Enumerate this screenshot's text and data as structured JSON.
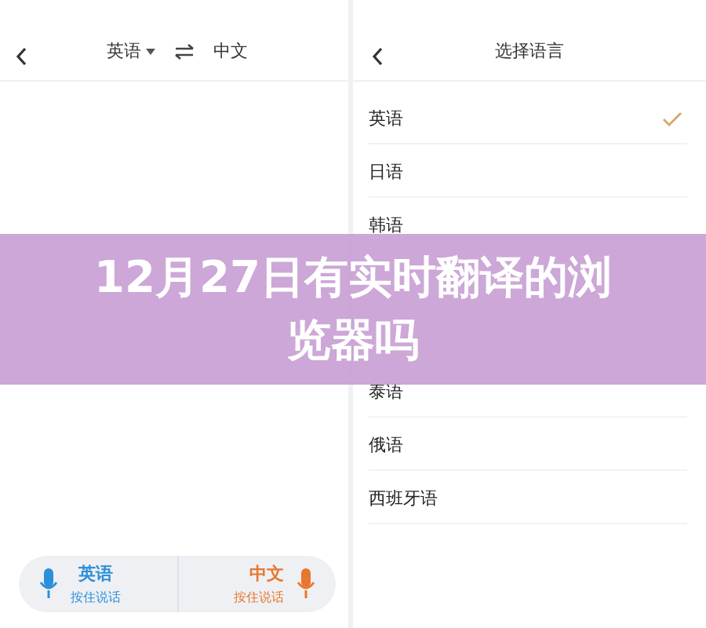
{
  "translator_screen": {
    "source_language": "英语",
    "target_language": "中文",
    "voice_buttons": [
      {
        "language": "英语",
        "hint": "按住说话",
        "color": "#2d8fd9"
      },
      {
        "language": "中文",
        "hint": "按住说话",
        "color": "#e8772e"
      }
    ]
  },
  "language_screen": {
    "title": "选择语言",
    "languages": [
      {
        "label": "英语",
        "selected": true
      },
      {
        "label": "日语",
        "selected": false
      },
      {
        "label": "韩语",
        "selected": false
      },
      {
        "label": "泰语",
        "selected": false
      },
      {
        "label": "俄语",
        "selected": false
      },
      {
        "label": "西班牙语",
        "selected": false
      }
    ]
  },
  "banner": {
    "title": "12月27日有实时翻译的浏览器吗"
  }
}
